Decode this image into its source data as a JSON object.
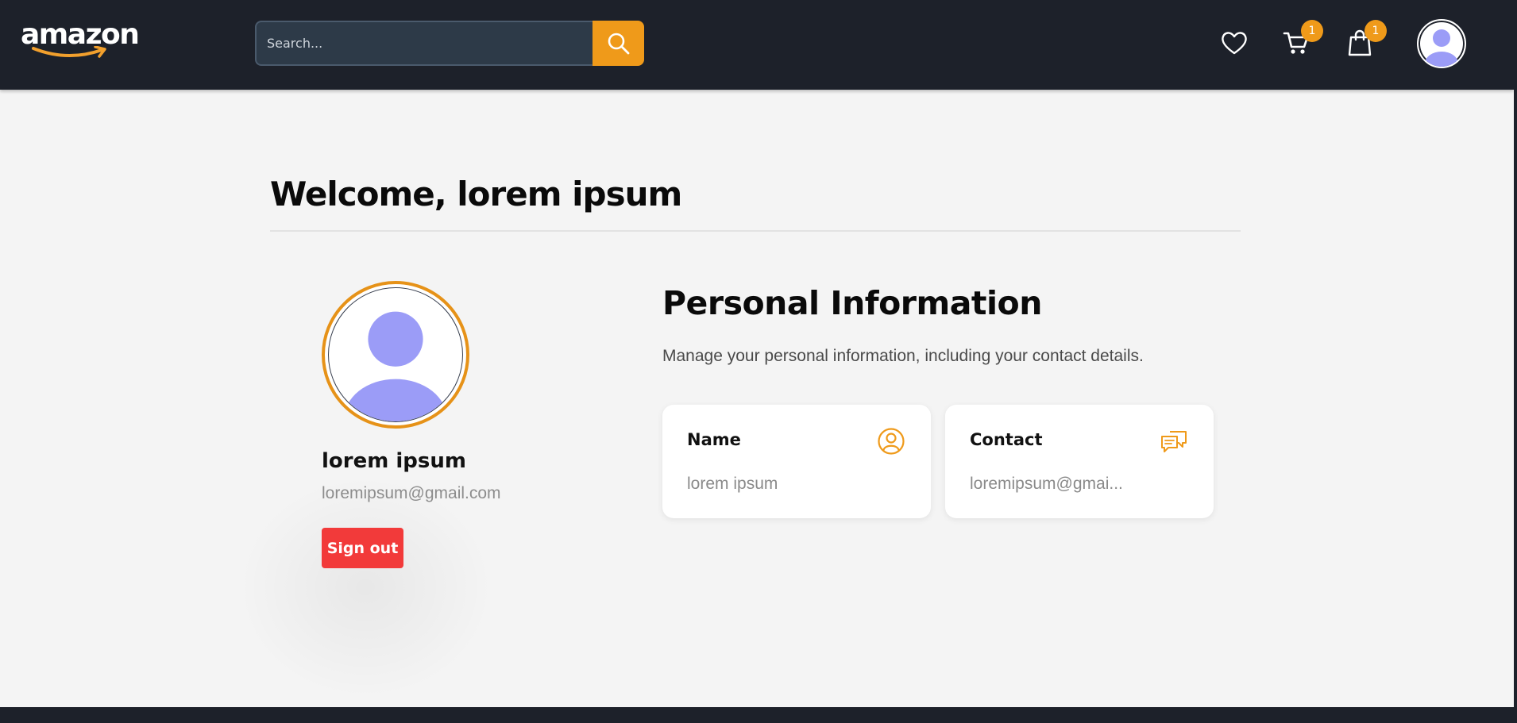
{
  "header": {
    "logo_text": "amazon",
    "search": {
      "placeholder": "Search..."
    },
    "cart_count": "1",
    "bag_count": "1"
  },
  "main": {
    "welcome": "Welcome, lorem ipsum",
    "profile": {
      "name": "lorem ipsum",
      "email": "loremipsum@gmail.com",
      "signout_label": "Sign out"
    },
    "personal_info": {
      "title": "Personal Information",
      "description": "Manage your personal information, including your contact details.",
      "cards": [
        {
          "title": "Name",
          "value": "lorem ipsum",
          "icon": "user-circle-icon"
        },
        {
          "title": "Contact",
          "value": "loremipsum@gmai...",
          "icon": "chat-bubbles-icon"
        }
      ]
    }
  },
  "colors": {
    "header_bg": "#1d212a",
    "accent": "#ef9a1a",
    "danger": "#f23a3a",
    "avatar": "#9b9cf7",
    "page_bg": "#f4f4f4"
  }
}
